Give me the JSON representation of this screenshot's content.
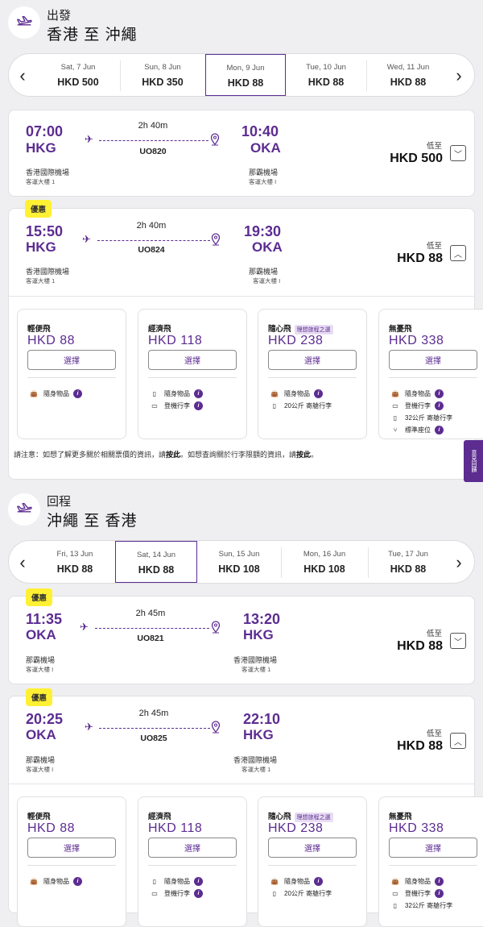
{
  "outbound": {
    "section_label": "出發",
    "route": "香港 至 沖繩",
    "dates": [
      {
        "day": "Sat, 7 Jun",
        "price": "HKD 500"
      },
      {
        "day": "Sun, 8 Jun",
        "price": "HKD 350"
      },
      {
        "day": "Mon, 9 Jun",
        "price": "HKD 88"
      },
      {
        "day": "Tue, 10 Jun",
        "price": "HKD 88"
      },
      {
        "day": "Wed, 11 Jun",
        "price": "HKD 88"
      }
    ],
    "flights": [
      {
        "dep_time": "07:00",
        "dep_code": "HKG",
        "dep_airport": "香港國際機場",
        "dep_terminal": "客運大樓 1",
        "duration": "2h 40m",
        "flight_no": "UO820",
        "arr_time": "10:40",
        "arr_code": "OKA",
        "arr_airport": "那霸機場",
        "arr_terminal": "客運大樓 I",
        "from_label": "低至",
        "price": "HKD 500"
      },
      {
        "promo": "優惠",
        "dep_time": "15:50",
        "dep_code": "HKG",
        "dep_airport": "香港國際機場",
        "dep_terminal": "客運大樓 1",
        "duration": "2h 40m",
        "flight_no": "UO824",
        "arr_time": "19:30",
        "arr_code": "OKA",
        "arr_airport": "那霸機場",
        "arr_terminal": "客運大樓 I",
        "from_label": "低至",
        "price": "HKD 88"
      }
    ],
    "fares": [
      {
        "name": "輕便飛",
        "tag": "",
        "price": "HKD 88",
        "select": "選擇",
        "features": [
          "隨身物品"
        ]
      },
      {
        "name": "經濟飛",
        "tag": "",
        "price": "HKD 118",
        "select": "選擇",
        "features": [
          "隨身物品",
          "登機行李"
        ]
      },
      {
        "name": "隨心飛",
        "tag": "理想旅程之選",
        "price": "HKD 238",
        "select": "選擇",
        "features": [
          "隨身物品",
          "20公斤 寄艙行李"
        ]
      },
      {
        "name": "無憂飛",
        "tag": "",
        "price": "HKD 338",
        "select": "選擇",
        "features": [
          "隨身物品",
          "登機行李",
          "32公斤 寄艙行李",
          "標準座位"
        ]
      }
    ],
    "note_a": "請注意：如想了解更多關於相關票價的資訊，請",
    "note_link1": "按此",
    "note_b": "。如想查詢關於行李限額的資訊，請",
    "note_link2": "按此",
    "note_c": "。"
  },
  "return": {
    "section_label": "回程",
    "route": "沖繩 至 香港",
    "dates": [
      {
        "day": "Fri, 13 Jun",
        "price": "HKD 88"
      },
      {
        "day": "Sat, 14 Jun",
        "price": "HKD 88"
      },
      {
        "day": "Sun, 15 Jun",
        "price": "HKD 108"
      },
      {
        "day": "Mon, 16 Jun",
        "price": "HKD 108"
      },
      {
        "day": "Tue, 17 Jun",
        "price": "HKD 88"
      }
    ],
    "flights": [
      {
        "promo": "優惠",
        "dep_time": "11:35",
        "dep_code": "OKA",
        "dep_airport": "那霸機場",
        "dep_terminal": "客運大樓 I",
        "duration": "2h 45m",
        "flight_no": "UO821",
        "arr_time": "13:20",
        "arr_code": "HKG",
        "arr_airport": "香港國際機場",
        "arr_terminal": "客運大樓 1",
        "from_label": "低至",
        "price": "HKD 88"
      },
      {
        "promo": "優惠",
        "dep_time": "20:25",
        "dep_code": "OKA",
        "dep_airport": "那霸機場",
        "dep_terminal": "客運大樓 I",
        "duration": "2h 45m",
        "flight_no": "UO825",
        "arr_time": "22:10",
        "arr_code": "HKG",
        "arr_airport": "香港國際機場",
        "arr_terminal": "客運大樓 1",
        "from_label": "低至",
        "price": "HKD 88"
      }
    ],
    "fares": [
      {
        "name": "輕便飛",
        "tag": "",
        "price": "HKD 88",
        "select": "選擇",
        "features": [
          "隨身物品"
        ]
      },
      {
        "name": "經濟飛",
        "tag": "",
        "price": "HKD 118",
        "select": "選擇",
        "features": [
          "隨身物品",
          "登機行李"
        ]
      },
      {
        "name": "隨心飛",
        "tag": "理想旅程之選",
        "price": "HKD 238",
        "select": "選擇",
        "features": [
          "隨身物品",
          "20公斤 寄艙行李"
        ]
      },
      {
        "name": "無憂飛",
        "tag": "",
        "price": "HKD 338",
        "select": "選擇",
        "features": [
          "隨身物品",
          "登機行李",
          "32公斤 寄艙行李"
        ]
      }
    ]
  },
  "feedback_tab": "意見回饋",
  "colors": {
    "brand": "#5c2c91",
    "promo": "#fff033",
    "background": "#efeff1"
  }
}
